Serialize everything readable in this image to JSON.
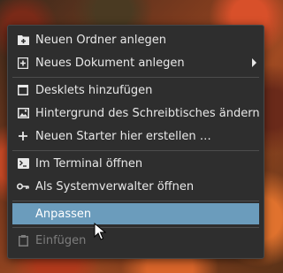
{
  "context_menu": {
    "items": [
      {
        "label": "Neuen Ordner anlegen",
        "icon": "folder-new-icon"
      },
      {
        "label": "Neues Dokument anlegen",
        "icon": "document-new-icon",
        "submenu": true
      },
      {
        "label": "Desklets hinzufügen",
        "icon": "desklet-icon"
      },
      {
        "label": "Hintergrund des Schreibtisches ändern",
        "icon": "image-icon"
      },
      {
        "label": "Neuen Starter hier erstellen …",
        "icon": "plus-icon"
      },
      {
        "label": "Im Terminal öffnen",
        "icon": "terminal-icon"
      },
      {
        "label": "Als Systemverwalter öffnen",
        "icon": "key-icon"
      },
      {
        "label": "Anpassen",
        "state": "highlighted"
      },
      {
        "label": "Einfügen",
        "icon": "clipboard-icon",
        "state": "disabled"
      }
    ]
  },
  "colors": {
    "menu_background": "#2e2e2e",
    "highlight": "#6b9cbc",
    "text": "#e8e8e8",
    "disabled_text": "#7d7d7d"
  }
}
